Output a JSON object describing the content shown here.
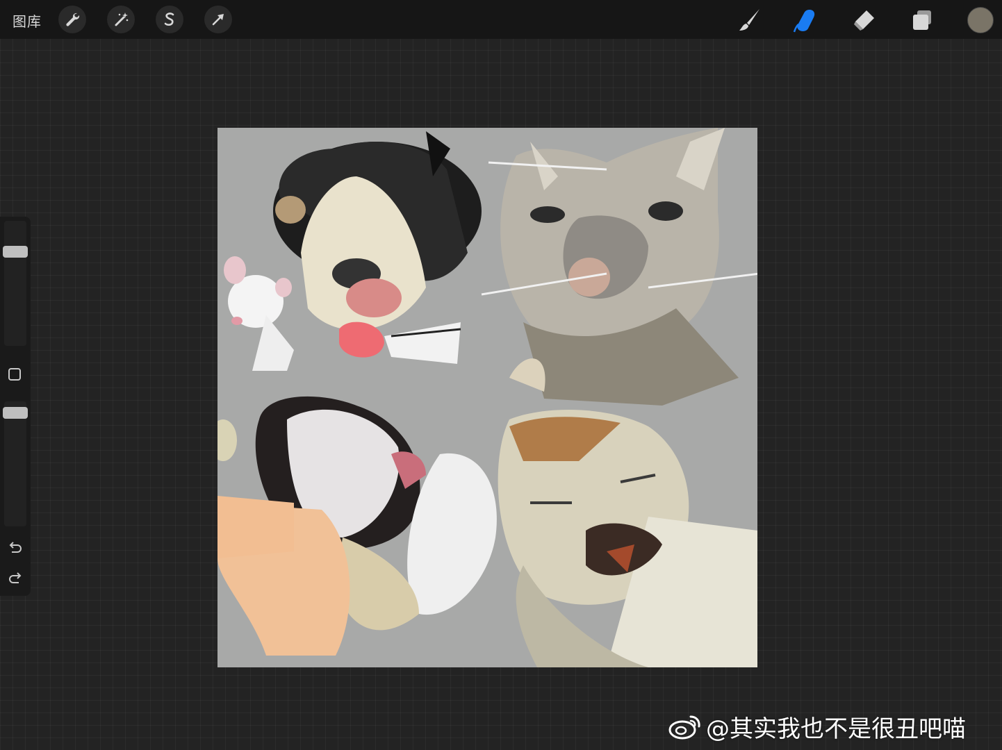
{
  "toolbar": {
    "gallery_label": "图库",
    "left_tools": [
      {
        "name": "actions",
        "icon": "wrench-icon"
      },
      {
        "name": "adjustments",
        "icon": "magic-wand-icon"
      },
      {
        "name": "selection",
        "icon": "selection-s-icon"
      },
      {
        "name": "transform",
        "icon": "arrow-cursor-icon"
      }
    ],
    "right_tools": [
      {
        "name": "brush",
        "icon": "brush-icon",
        "active": false
      },
      {
        "name": "smudge",
        "icon": "smudge-finger-icon",
        "active": true
      },
      {
        "name": "eraser",
        "icon": "eraser-icon",
        "active": false
      },
      {
        "name": "layers",
        "icon": "layers-icon",
        "active": false
      }
    ],
    "current_color": "#7a7467",
    "active_tool_color": "#1a7cf2"
  },
  "sidebar": {
    "brush_size_level": 0.78,
    "opacity_level": 0.95,
    "modify_button_icon": "square-icon",
    "undo_icon": "undo-icon",
    "redo_icon": "redo-icon"
  },
  "canvas": {
    "background_color": "#a8a9a8",
    "content": "painting"
  },
  "watermark": {
    "text": "@其实我也不是很丑吧喵",
    "logo": "weibo-logo"
  }
}
